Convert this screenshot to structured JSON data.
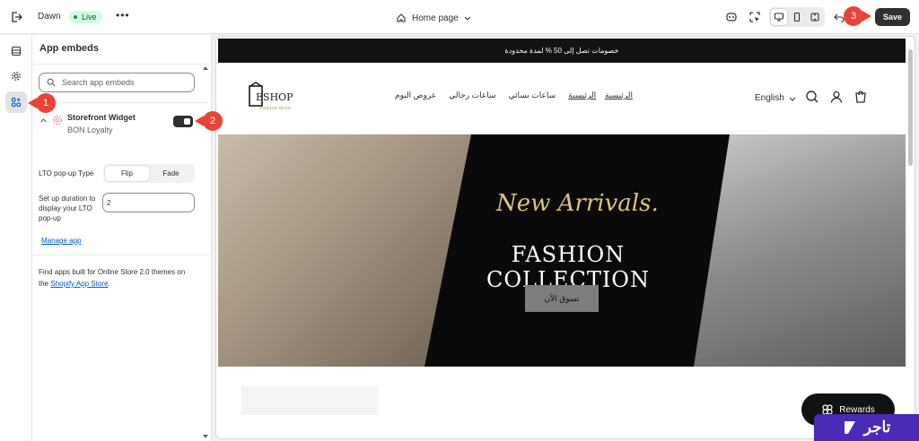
{
  "topbar": {
    "theme_name": "Dawn",
    "status_badge": "Live",
    "page_selector": "Home page",
    "save_label": "Save"
  },
  "sidebar_panel": {
    "title": "App embeds",
    "search_placeholder": "Search app embeds",
    "widget": {
      "name": "Storefront Widget",
      "app": "BON Loyalty",
      "enabled": true
    },
    "lto_popup_type": {
      "label": "LTO pop-up Type",
      "options": [
        "Flip",
        "Fade"
      ],
      "selected": "Flip"
    },
    "duration": {
      "label": "Set up duration to display your LTO pop-up",
      "value": "2"
    },
    "manage_link": "Manage app",
    "find_apps_text": "Find apps built for Online Store 2.0 themes on the",
    "find_apps_link": "Shopify App Store",
    "find_apps_end": "."
  },
  "markers": [
    "1",
    "2",
    "3"
  ],
  "preview": {
    "announcement": "خصومات تصل إلى 50 % لمدة محدودة",
    "logo_text": "ESHOP",
    "logo_sub": "Fashion Store",
    "nav": [
      "الرئيسية",
      "ساعات نسائي",
      "ساعات رجالي",
      "عروض اليوم",
      "الرئيسية"
    ],
    "language": "English",
    "hero_script": "New Arrivals.",
    "hero_title_1": "FASHION",
    "hero_title_2": "COLLECTION",
    "hero_button": "تسوق الآن",
    "rewards_label": "Rewards"
  },
  "brand_watermark": "تاجر",
  "colors": {
    "accent_marker": "#e8443a",
    "save_bg": "#303030",
    "live_badge": "#cdfee1",
    "link": "#005bd3",
    "brand": "#4a2ab8",
    "hero_script": "#e0c27a"
  }
}
